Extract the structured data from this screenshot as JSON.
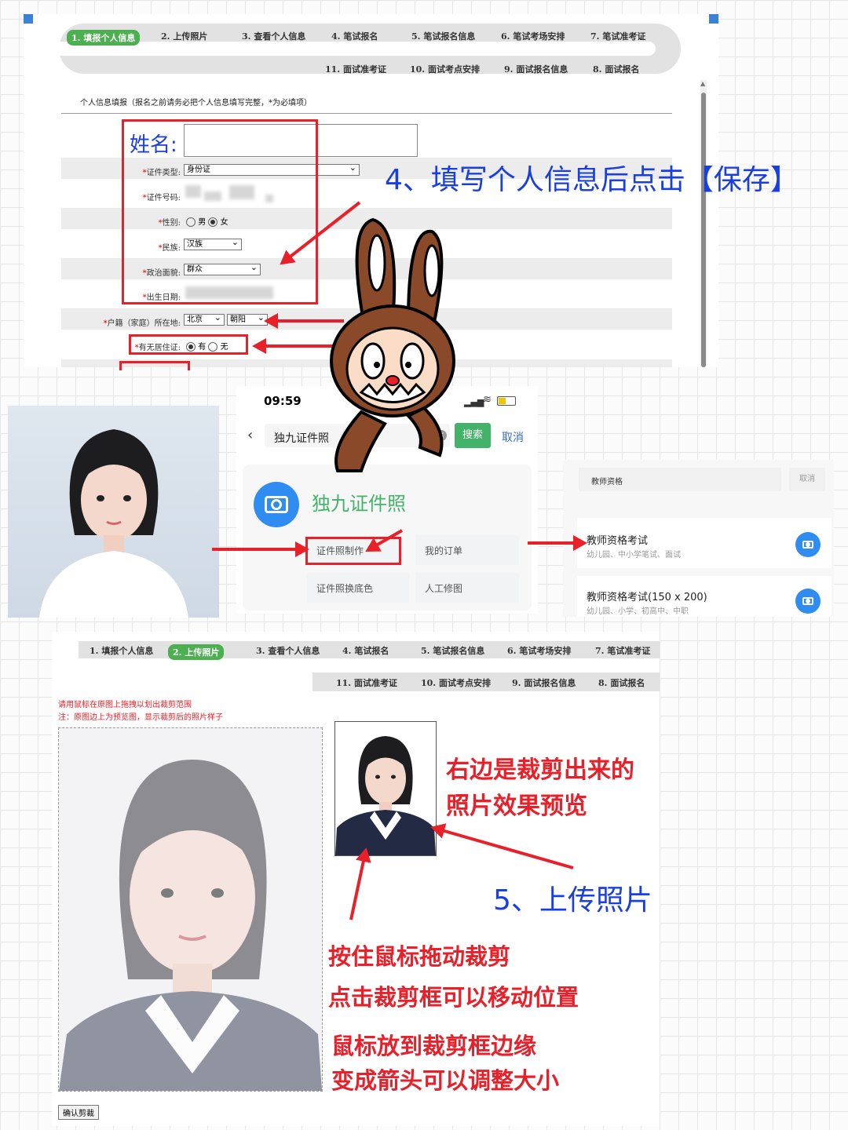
{
  "step_tabs_top": {
    "row1": [
      "1. 填报个人信息",
      "2. 上传照片",
      "3. 查看个人信息",
      "4. 笔试报名",
      "5. 笔试报名信息",
      "6. 笔试考场安排",
      "7. 笔试准考证"
    ],
    "row2": [
      "11. 面试准考证",
      "10. 面试考点安排",
      "9. 面试报名信息",
      "8. 面试报名"
    ]
  },
  "form": {
    "section_title": "个人信息填报（报名之前请务必把个人信息填写完整，*为必填项）",
    "name_label": "姓名:",
    "id_type_label": "证件类型:",
    "id_type_value": "身份证",
    "id_number_label": "证件号码:",
    "gender_label": "性别:",
    "gender_male": "男",
    "gender_female": "女",
    "ethnic_label": "民族:",
    "ethnic_value": "汉族",
    "political_label": "政治面貌:",
    "political_value": "群众",
    "birth_label": "出生日期:",
    "hukou_label": "户籍（家庭）所在地:",
    "hukou_province": "北京",
    "hukou_city": "朝阳",
    "residence_label": "有无居住证:",
    "residence_yes": "有",
    "residence_no": "无",
    "required_mark": "*"
  },
  "annotations": {
    "step4": "4、填写个人信息后点击【保存】",
    "preview_line1": "右边是裁剪出来的",
    "preview_line2": "照片效果预览",
    "step5": "5、上传照片",
    "drag_crop": "按住鼠标拖动裁剪",
    "move_crop": "点击裁剪框可以移动位置",
    "resize1": "鼠标放到裁剪框边缘",
    "resize2": "变成箭头可以调整大小"
  },
  "phone": {
    "time": "09:59",
    "search_value": "独九证件照",
    "search_button": "搜索",
    "cancel": "取消",
    "app_name": "独九证件照",
    "btn_make": "证件照制作",
    "btn_orders": "我的订单",
    "btn_bg": "证件照换底色",
    "btn_retouch": "人工修图"
  },
  "search_panel": {
    "query": "教师资格",
    "cancel": "取消",
    "item1_title": "教师资格考试",
    "item1_sub": "幼儿园、中小学笔试、面试",
    "item2_title": "教师资格考试(150 x 200)",
    "item2_sub": "幼儿园、小学、初高中、中职"
  },
  "step_tabs_bottom": {
    "row1": [
      "1. 填报个人信息",
      "2. 上传照片",
      "3. 查看个人信息",
      "4. 笔试报名",
      "5. 笔试报名信息",
      "6. 笔试考场安排",
      "7. 笔试准考证"
    ],
    "row2": [
      "11. 面试准考证",
      "10. 面试考点安排",
      "9. 面试报名信息",
      "8. 面试报名"
    ]
  },
  "crop": {
    "instruction1": "请用鼠标在原图上拖拽以划出裁剪范围",
    "instruction2": "注：原图边上为预览图，显示裁剪后的照片样子",
    "confirm_button": "确认剪裁"
  },
  "colors": {
    "accent_green": "#4caf50",
    "annotation_red": "#e8202a",
    "annotation_blue": "#1a3fe0",
    "camera_blue": "#2f8cf0"
  }
}
